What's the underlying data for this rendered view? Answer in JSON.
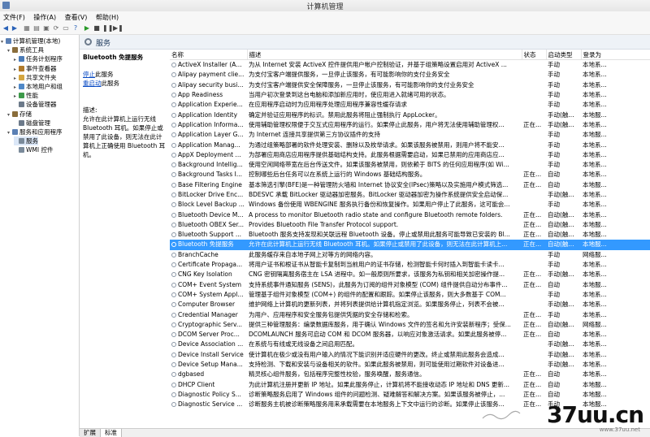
{
  "window": {
    "title": "计算机管理"
  },
  "menu": [
    "文件(F)",
    "操作(A)",
    "查看(V)",
    "帮助(H)"
  ],
  "tree": [
    {
      "label": "计算机管理(本地)",
      "level": 0,
      "color": "#5a7fb4",
      "toggle": "▾"
    },
    {
      "label": "系统工具",
      "level": 1,
      "color": "#8a6d3b",
      "toggle": "▾"
    },
    {
      "label": "任务计划程序",
      "level": 2,
      "color": "#4a7bb7",
      "toggle": "▸"
    },
    {
      "label": "事件查看器",
      "level": 2,
      "color": "#b07a2a",
      "toggle": "▸"
    },
    {
      "label": "共享文件夹",
      "level": 2,
      "color": "#d4a640",
      "toggle": "▸"
    },
    {
      "label": "本地用户和组",
      "level": 2,
      "color": "#4f88c7",
      "toggle": "▸"
    },
    {
      "label": "性能",
      "level": 2,
      "color": "#3d9a4a",
      "toggle": "▸"
    },
    {
      "label": "设备管理器",
      "level": 2,
      "color": "#6c7a8a",
      "toggle": ""
    },
    {
      "label": "存储",
      "level": 1,
      "color": "#8a6d3b",
      "toggle": "▾"
    },
    {
      "label": "磁盘管理",
      "level": 2,
      "color": "#6c7a8a",
      "toggle": ""
    },
    {
      "label": "服务和应用程序",
      "level": 1,
      "color": "#5a7fb4",
      "toggle": "▾"
    },
    {
      "label": "服务",
      "level": 2,
      "color": "#7a8a9a",
      "toggle": ""
    },
    {
      "label": "WMI 控件",
      "level": 2,
      "color": "#7a8a9a",
      "toggle": ""
    }
  ],
  "panel": {
    "title": "服务"
  },
  "details": {
    "name": "Bluetooth 免提服务",
    "stop_link": "停止",
    "stop_suffix": "此服务",
    "restart_link": "重启动",
    "restart_suffix": "此服务",
    "desc_label": "描述:",
    "desc_text": "允许在此计算机上运行无线 Bluetooth 耳机。如果停止或禁用了此设备，则无法在此计算机上正确使用 Bluetooth 耳机。"
  },
  "columns": [
    "名称",
    "描述",
    "状态",
    "启动类型",
    "登录为"
  ],
  "services": [
    [
      "ActiveX Installer (A...",
      "为从 Internet 安装 ActiveX 控件提供用户帐户控制验证，并基于组策略设置启用对 ActiveX ...",
      "",
      "手动",
      "本地系..."
    ],
    [
      "Alipay payment clie...",
      "为支付宝客户端提供服务，一旦停止该服务，有可能影响你的支付业务安全",
      "",
      "手动",
      "本地系..."
    ],
    [
      "Alipay security busi...",
      "为支付宝客户端提供安全保障服务，一旦停止该服务，有可能影响你的支付业务安全",
      "",
      "手动",
      "本地系..."
    ],
    [
      "App Readiness",
      "当用户初次登录到这台电脑和添加新应用时，使应用进入就绪可用的状态。",
      "",
      "手动",
      "本地系..."
    ],
    [
      "Application Experie...",
      "在应用程序启动时为应用程序处理应用程序兼容性缓存请求",
      "",
      "手动",
      "本地系..."
    ],
    [
      "Application Identity",
      "确定并验证应用程序的标识。禁用此服务将阻止强制执行 AppLocker。",
      "",
      "手动(触...",
      "本地服..."
    ],
    [
      "Application Informa...",
      "使用辅助管理权限便于交互式应用程序的运行。如果停止此服务，用户将无法使用辅助管理权...",
      "正在...",
      "手动(触...",
      "本地系..."
    ],
    [
      "Application Layer G...",
      "为 Internet 连接共享提供第三方协议插件的支持",
      "",
      "手动",
      "本地服..."
    ],
    [
      "Application Manag...",
      "为通过组策略部署的软件处理安装、删除以及枚举请求。如果该服务被禁用，则用户将不能安...",
      "",
      "手动",
      "本地系..."
    ],
    [
      "AppX Deployment ...",
      "为部署应用商店应用程序提供基础结构支持。此服务根据需要启动，如果已禁用的应用商店应...",
      "",
      "手动",
      "本地系..."
    ],
    [
      "Background Intellig...",
      "使用空闲网络带宽在后台传送文件。如果该服务被禁用，则依赖于 BITS 的任何应用程序(如 Wi...",
      "",
      "手动",
      "本地系..."
    ],
    [
      "Background Tasks I...",
      "控制哪些后台任务可以在系统上运行的 Windows 基础结构服务。",
      "正在...",
      "自动",
      "本地系..."
    ],
    [
      "Base Filtering Engine",
      "基本筛选引擎(BFE)是一种管理防火墙和 Internet 协议安全(IPsec)策略以及实施用户模式筛选...",
      "正在...",
      "自动",
      "本地服..."
    ],
    [
      "BitLocker Drive Enc...",
      "BDESVC 承载 BitLocker 驱动器加密服务。BitLocker 驱动器加密为操作系统提供安全启动保...",
      "",
      "手动(触...",
      "本地系..."
    ],
    [
      "Block Level Backup ...",
      "Windows 备份使用 WBENGINE 服务执行备份和恢复操作。如果用户停止了此服务，这可能会...",
      "",
      "手动",
      "本地系..."
    ],
    [
      "Bluetooth Device M...",
      "A process to monitor Bluetooth radio state and configure Bluetooth remote folders.",
      "正在...",
      "自动(触...",
      "本地系..."
    ],
    [
      "Bluetooth OBEX Ser...",
      "Provides Bluetooth File Transfer Protocol support.",
      "正在...",
      "自动(触...",
      "本地服..."
    ],
    [
      "Bluetooth Support ...",
      "Bluetooth 服务支持发现和关联远程 Bluetooth 设备。停止或禁用此服务可能导致已安装的 Bl...",
      "正在...",
      "自动(触...",
      "本地服..."
    ],
    [
      "Bluetooth 免提服务",
      "允许在此计算机上运行无线 Bluetooth 耳机。如果停止或禁用了此设备，则无法在此计算机上...",
      "正在...",
      "自动(触...",
      "本地服..."
    ],
    [
      "BranchCache",
      "此服务缓存来自本地子网上对等方的网络内容。",
      "",
      "手动",
      "网络服..."
    ],
    [
      "Certificate Propaga...",
      "将用户证书和根证书从智能卡复制到当前用户的证书存储，检测智能卡何时插入到智能卡读卡...",
      "",
      "手动",
      "本地系..."
    ],
    [
      "CNG Key Isolation",
      "CNG 密钥隔离服务宿主在 LSA 进程中。如一般原则所要求，该服务为私钥和相关加密操作提...",
      "正在...",
      "手动(触...",
      "本地系..."
    ],
    [
      "COM+ Event System",
      "支持系统事件通知服务 (SENS)，此服务为订阅的组件对象模型 (COM) 组件提供自动分布事件...",
      "正在...",
      "自动",
      "本地服..."
    ],
    [
      "COM+ System Appl...",
      "管理基于组件对象模型 (COM+) 的组件的配置和跟踪。如果停止该服务，则大多数基于 COM...",
      "",
      "手动",
      "本地系..."
    ],
    [
      "Computer Browser",
      "维护网络上计算机的更新列表，并将列表提供给计算机指定浏览。如果服务停止，列表不会被...",
      "",
      "手动(触...",
      "本地系..."
    ],
    [
      "Credential Manager",
      "为用户、应用程序和安全服务包提供凭据的安全存储和检索。",
      "正在...",
      "手动",
      "本地系..."
    ],
    [
      "Cryptographic Serv...",
      "提供三种管理服务：编录数据库服务，用于确认 Windows 文件的签名和允许安装新程序；受保...",
      "正在...",
      "自动(触...",
      "网络服..."
    ],
    [
      "DCOM Server Proc...",
      "DCOMLAUNCH 服务可启动 COM 和 DCOM 服务器，以响应对象激活请求。如果此服务被停...",
      "正在...",
      "自动",
      "本地系..."
    ],
    [
      "Device Association ...",
      "在系统与有线或无线设备之间启用匹配。",
      "",
      "手动(触...",
      "本地系..."
    ],
    [
      "Device Install Service",
      "使计算机在极少或没有用户输入的情况下能识别并适应硬件的更改。终止或禁用此服务会造成...",
      "",
      "手动(触...",
      "本地系..."
    ],
    [
      "Device Setup Mana...",
      "支持检测、下载和安装与设备相关的软件。如果此服务被禁用，则可能使用过期软件对设备进...",
      "",
      "手动(触...",
      "本地系..."
    ],
    [
      "dgbased",
      "精灵核心组件服务，包括程序完整性校验，服务唤醒，服务通信。",
      "正在...",
      "自动",
      "本地系..."
    ],
    [
      "DHCP Client",
      "为此计算机注册并更新 IP 地址。如果此服务停止，计算机将不能接收动态 IP 地址和 DNS 更新...",
      "正在...",
      "自动",
      "本地服..."
    ],
    [
      "Diagnostic Policy S...",
      "诊断策略服务启用了 Windows 组件的问题检测、疑难解答和解决方案。如果该服务被停止，...",
      "正在...",
      "自动",
      "本地服..."
    ],
    [
      "Diagnostic Service ...",
      "诊断服务主机被诊断策略服务用来承载需要在本地服务上下文中运行的诊断。如果停止该服务...",
      "正在...",
      "手动",
      "本地服..."
    ]
  ],
  "selected_index": 18,
  "tabs": [
    "扩展",
    "标准"
  ],
  "watermark": {
    "main": "37uu.cn",
    "sub": "www.37uu.net"
  },
  "colors": {
    "selection": "#3399ff",
    "link": "#0a4bc4",
    "header_bg": "#eef2f7"
  }
}
